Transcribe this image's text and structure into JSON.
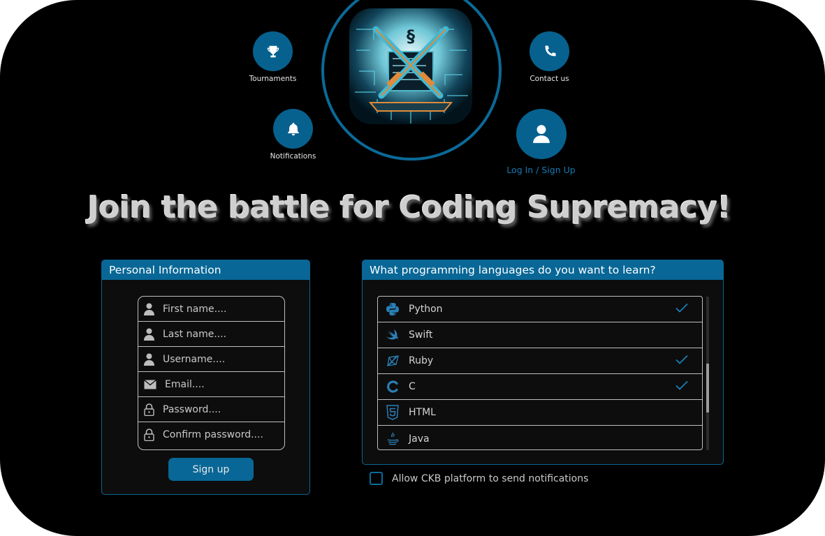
{
  "nav": {
    "tournaments": "Tournaments",
    "notifications": "Notifications",
    "contact": "Contact us",
    "login": "Log In / Sign Up"
  },
  "headline": "Join the battle for Coding Supremacy!",
  "personal": {
    "title": "Personal Information",
    "fields": [
      {
        "placeholder": "First name....",
        "icon": "user-icon"
      },
      {
        "placeholder": "Last name....",
        "icon": "user-icon"
      },
      {
        "placeholder": "Username....",
        "icon": "user-icon"
      },
      {
        "placeholder": "Email....",
        "icon": "envelope-icon"
      },
      {
        "placeholder": "Password....",
        "icon": "lock-icon"
      },
      {
        "placeholder": "Confirm password....",
        "icon": "lock-icon"
      }
    ],
    "submit": "Sign up"
  },
  "languages": {
    "title": "What programming languages do you want to learn?",
    "items": [
      {
        "name": "Python",
        "icon": "python-icon",
        "checked": true
      },
      {
        "name": "Swift",
        "icon": "swift-icon",
        "checked": false
      },
      {
        "name": "Ruby",
        "icon": "ruby-icon",
        "checked": true
      },
      {
        "name": "C",
        "icon": "c-icon",
        "checked": true
      },
      {
        "name": "HTML",
        "icon": "html5-icon",
        "checked": false
      },
      {
        "name": "Java",
        "icon": "java-icon",
        "checked": false
      }
    ]
  },
  "notify_label": "Allow CKB platform to send notifications",
  "colors": {
    "accent": "#086796",
    "background": "#000000",
    "panel": "#0d0d0d",
    "check": "#1a7fb8"
  }
}
